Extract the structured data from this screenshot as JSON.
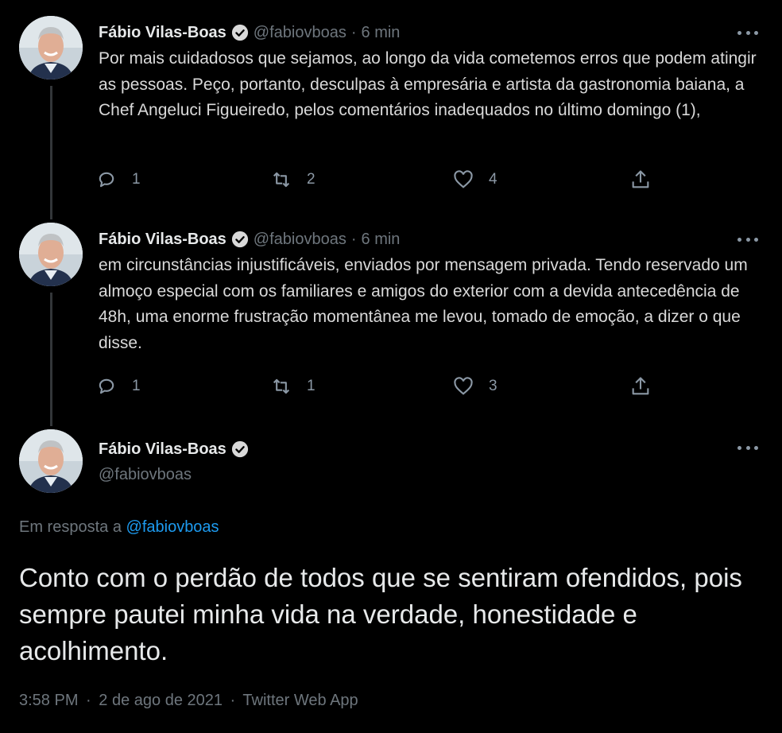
{
  "tweets": [
    {
      "name": "Fábio Vilas-Boas",
      "handle": "@fabiovboas",
      "separator": "·",
      "time": "6 min",
      "text": "Por mais cuidadosos que sejamos, ao longo da vida cometemos erros que podem atingir as pessoas. Peço, portanto, desculpas à empresária e artista da gastronomia baiana, a Chef Angeluci Figueiredo, pelos comentários inadequados no último domingo (1),",
      "replies": "1",
      "retweets": "2",
      "likes": "4"
    },
    {
      "name": "Fábio Vilas-Boas",
      "handle": "@fabiovboas",
      "separator": "·",
      "time": "6 min",
      "text": "em circunstâncias injustificáveis, enviados por mensagem privada. Tendo reservado um almoço especial com os familiares e amigos do exterior com a devida antecedência de 48h, uma enorme frustração momentânea me levou, tomado de emoção, a dizer o que disse.",
      "replies": "1",
      "retweets": "1",
      "likes": "3"
    }
  ],
  "focused": {
    "name": "Fábio Vilas-Boas",
    "handle": "@fabiovboas",
    "reply_prefix": "Em resposta a",
    "reply_handle": "@fabiovboas",
    "text": "Conto com o perdão de todos que se sentiram ofendidos, pois sempre pautei minha vida na verdade, honestidade e acolhimento.",
    "time": "3:58 PM",
    "separator": "·",
    "date": "2 de ago de 2021",
    "source": "Twitter Web App"
  },
  "icons": {
    "verified": "verified-badge-icon",
    "reply": "reply-icon",
    "retweet": "retweet-icon",
    "like": "heart-icon",
    "share": "share-icon",
    "more": "more-icon"
  },
  "colors": {
    "background": "#000000",
    "link": "#1d9bf0",
    "muted": "#6e767d"
  }
}
